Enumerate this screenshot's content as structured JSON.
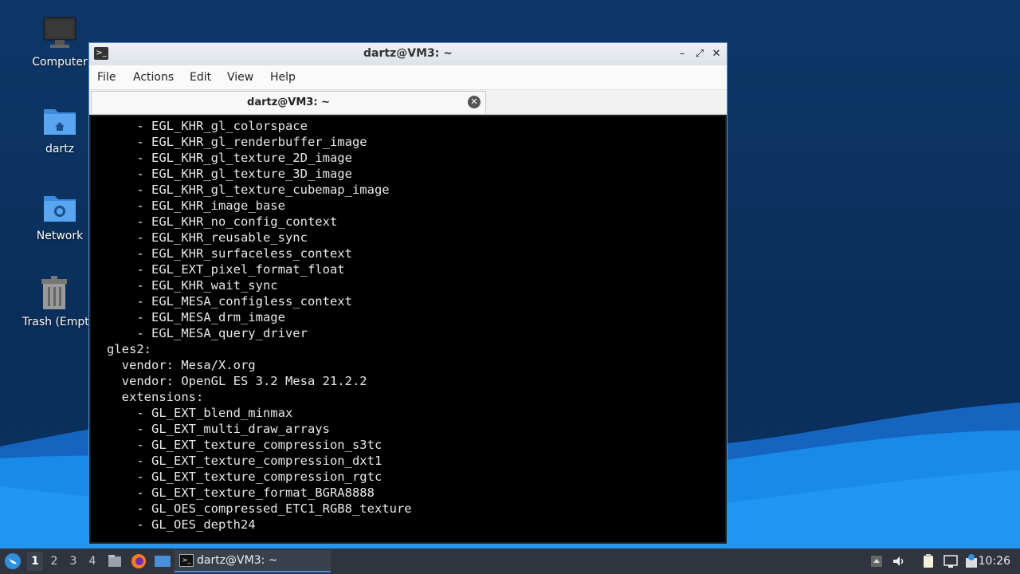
{
  "desktop": {
    "icons": [
      {
        "label": "Computer"
      },
      {
        "label": "dartz"
      },
      {
        "label": "Network"
      },
      {
        "label": "Trash (Empt"
      }
    ]
  },
  "window": {
    "title": "dartz@VM3: ~",
    "menu": [
      "File",
      "Actions",
      "Edit",
      "View",
      "Help"
    ],
    "tab_label": "dartz@VM3: ~",
    "terminal_lines": [
      "    - EGL_KHR_gl_colorspace",
      "    - EGL_KHR_gl_renderbuffer_image",
      "    - EGL_KHR_gl_texture_2D_image",
      "    - EGL_KHR_gl_texture_3D_image",
      "    - EGL_KHR_gl_texture_cubemap_image",
      "    - EGL_KHR_image_base",
      "    - EGL_KHR_no_config_context",
      "    - EGL_KHR_reusable_sync",
      "    - EGL_KHR_surfaceless_context",
      "    - EGL_EXT_pixel_format_float",
      "    - EGL_KHR_wait_sync",
      "    - EGL_MESA_configless_context",
      "    - EGL_MESA_drm_image",
      "    - EGL_MESA_query_driver",
      "gles2:",
      "  vendor: Mesa/X.org",
      "  vendor: OpenGL ES 3.2 Mesa 21.2.2",
      "  extensions:",
      "    - GL_EXT_blend_minmax",
      "    - GL_EXT_multi_draw_arrays",
      "    - GL_EXT_texture_compression_s3tc",
      "    - GL_EXT_texture_compression_dxt1",
      "    - GL_EXT_texture_compression_rgtc",
      "    - GL_EXT_texture_format_BGRA8888",
      "    - GL_OES_compressed_ETC1_RGB8_texture",
      "    - GL_OES_depth24"
    ]
  },
  "taskbar": {
    "workspaces": [
      "1",
      "2",
      "3",
      "4"
    ],
    "active_workspace": "1",
    "task_label": "dartz@VM3: ~",
    "clock": "10:26"
  },
  "colors": {
    "accent": "#4a90d9",
    "terminal_bg": "#000000",
    "taskbar_bg": "#2f343f"
  }
}
